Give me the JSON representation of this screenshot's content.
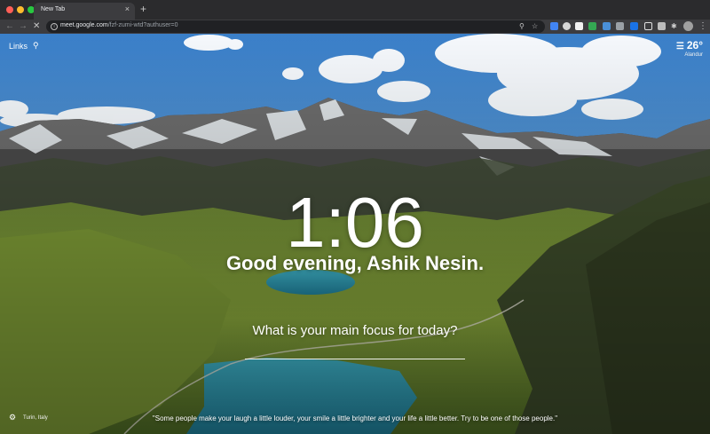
{
  "browser": {
    "tab_title": "New Tab",
    "tab_close": "×",
    "new_tab": "+",
    "back": "←",
    "forward": "→",
    "stop": "✕",
    "url_host": "meet.google.com",
    "url_path": "/fzf-zumi-wtd?authuser=0",
    "toolbar_icons": [
      "location-pin-icon",
      "star-icon",
      "extension-icons",
      "puzzle-icon",
      "profile-avatar",
      "menu-icon"
    ],
    "extension_colors": [
      "#4285f4",
      "#e0e0e0",
      "#ffffff",
      "#34a853",
      "#4a90d9",
      "#9aa0a6",
      "#1a73e8",
      "#ffffff",
      "#9aa0a6"
    ]
  },
  "momentum": {
    "links_label": "Links",
    "weather_temp": "26°",
    "weather_location": "Alandur",
    "time": "1:06",
    "greeting": "Good evening, Ashik Nesin.",
    "focus_prompt": "What is your main focus for today?",
    "photo_location": "Turin, Italy",
    "quote": "\"Some people make your laugh a little louder, your smile a little brighter and your life a little better. Try to be one of those people.\""
  }
}
